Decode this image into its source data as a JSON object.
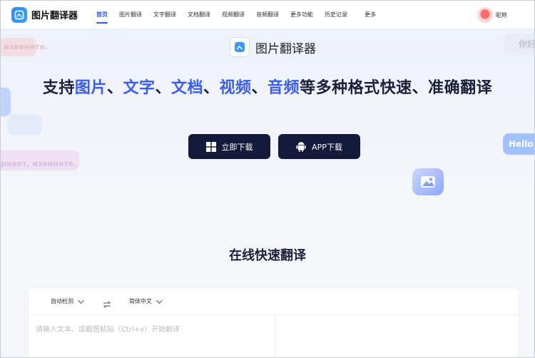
{
  "header": {
    "app_name": "图片翻译器",
    "nav": [
      {
        "label": "首页",
        "active": true
      },
      {
        "label": "图片翻译",
        "active": false
      },
      {
        "label": "文字翻译",
        "active": false
      },
      {
        "label": "文档翻译",
        "active": false
      },
      {
        "label": "视频翻译",
        "active": false
      },
      {
        "label": "音频翻译",
        "active": false
      },
      {
        "label": "更多功能",
        "active": false
      },
      {
        "label": "历史记录",
        "active": false
      },
      {
        "label": "更多",
        "active": false
      }
    ],
    "user": {
      "nickname": "昵称"
    }
  },
  "hero": {
    "brand": "图片翻译器",
    "title_parts": [
      {
        "text": "支持",
        "hl": false
      },
      {
        "text": "图片",
        "hl": true
      },
      {
        "text": "、",
        "hl": false
      },
      {
        "text": "文字",
        "hl": true
      },
      {
        "text": "、",
        "hl": false
      },
      {
        "text": "文档",
        "hl": true
      },
      {
        "text": "、",
        "hl": false
      },
      {
        "text": "视频",
        "hl": true
      },
      {
        "text": "、",
        "hl": false
      },
      {
        "text": "音频",
        "hl": true
      },
      {
        "text": "等多种格式快速、准确翻译",
        "hl": false
      }
    ],
    "buttons": {
      "windows": "立即下载",
      "app": "APP下载"
    },
    "deco": {
      "ru_top": "извините.",
      "ru_bottom": "ривет, извините.",
      "zh": "你好",
      "en": "Hello."
    }
  },
  "section": {
    "title": "在线快速翻译"
  },
  "translator": {
    "source_lang": "自动检测",
    "target_lang": "简体中文",
    "placeholder": "请输入文本、或截图粘贴（Ctrl+v）开始翻译"
  },
  "colors": {
    "accent": "#3a5cff",
    "nav_active": "#2d5bff",
    "button_dark": "#141a3c"
  }
}
